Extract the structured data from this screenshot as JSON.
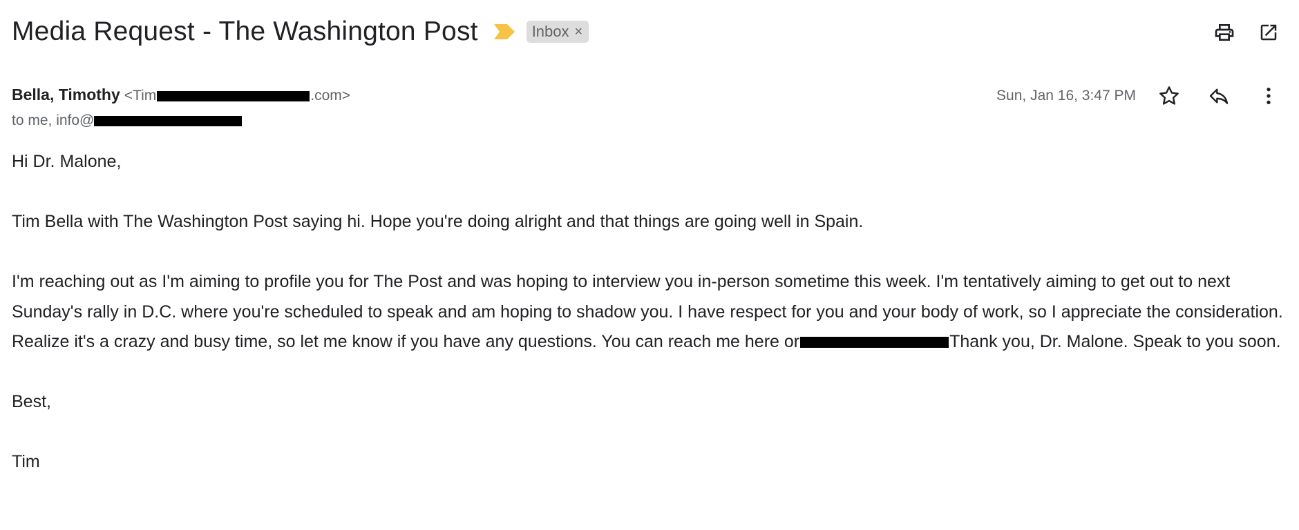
{
  "email": {
    "subject": "Media Request - The Washington Post",
    "label": "Inbox",
    "label_close": "×",
    "sender_name": "Bella, Timothy",
    "sender_email_prefix": "<Tim",
    "sender_email_suffix": ".com>",
    "recipients_prefix": "to me, info@",
    "date": "Sun, Jan 16, 3:47 PM",
    "body": {
      "greeting": "Hi Dr. Malone,",
      "para1": "Tim Bella with The Washington Post saying hi. Hope you're doing alright and that things are going well in Spain.",
      "para2_part1": "I'm reaching out as I'm aiming to profile you for The Post and was hoping to interview you in-person sometime this week. I'm tentatively aiming to get out to next Sunday's rally in D.C. where you're scheduled to speak and am hoping to shadow you. I have respect for you and your body of work, so I appreciate the consideration. Realize it's a crazy and busy time, so let me know if you have any questions. You can reach me here or",
      "para2_part2": "Thank you, Dr. Malone. Speak to you soon.",
      "closing": "Best,",
      "signature": "Tim"
    }
  },
  "icons": {
    "print": "print-icon",
    "open_new": "open-in-new-window-icon",
    "importance": "importance-marker-icon",
    "star": "star-icon",
    "reply": "reply-icon",
    "more": "more-vert-icon"
  },
  "colors": {
    "importance": "#f6c344",
    "chip_bg": "#dddddd",
    "secondary_text": "#5f6368",
    "primary_text": "#202124",
    "redaction": "#000000"
  }
}
